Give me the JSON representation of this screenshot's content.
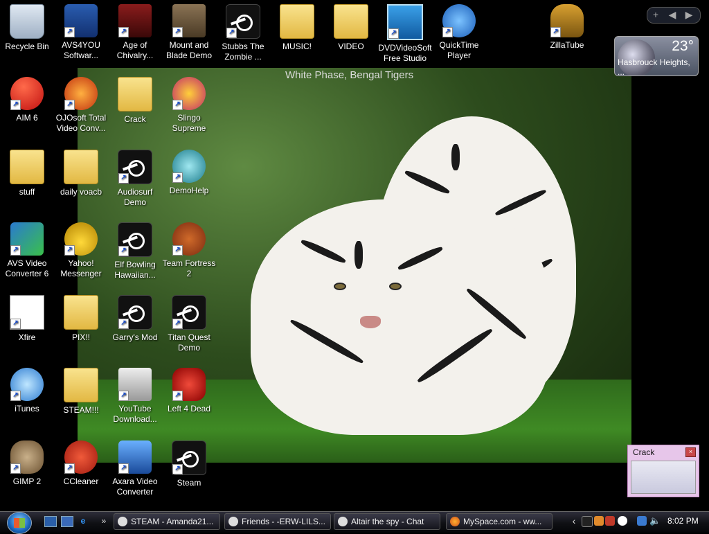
{
  "wallpaper": {
    "title": "White Phase, Bengal Tigers"
  },
  "desktop_icons": [
    {
      "label": "Recycle Bin",
      "icon": "recycle-bin-icon"
    },
    {
      "label": "AVS4YOU Softwar...",
      "icon": "avs4you-icon"
    },
    {
      "label": "Age of Chivalry...",
      "icon": "age-of-chivalry-icon"
    },
    {
      "label": "Mount and Blade Demo",
      "icon": "mount-blade-icon"
    },
    {
      "label": "Stubbs The Zombie ...",
      "icon": "steam-icon"
    },
    {
      "label": "MUSIC!",
      "icon": "folder-icon"
    },
    {
      "label": "VIDEO",
      "icon": "folder-icon"
    },
    {
      "label": "DVDVideoSoft Free Studio",
      "icon": "dvdvideosoft-icon"
    },
    {
      "label": "QuickTime Player",
      "icon": "quicktime-icon"
    },
    {
      "label": "ZillaTube",
      "icon": "zillatube-icon"
    },
    {
      "label": "AIM 6",
      "icon": "aim-icon"
    },
    {
      "label": "OJOsoft Total Video Conv...",
      "icon": "ojosoft-icon"
    },
    {
      "label": "Crack",
      "icon": "folder-icon"
    },
    {
      "label": "Slingo Supreme",
      "icon": "slingo-icon"
    },
    {
      "label": "stuff",
      "icon": "folder-icon"
    },
    {
      "label": "daily voacb",
      "icon": "folder-icon"
    },
    {
      "label": "Audiosurf Demo",
      "icon": "steam-icon"
    },
    {
      "label": "DemoHelp",
      "icon": "demohelp-icon"
    },
    {
      "label": "AVS Video Converter 6",
      "icon": "avs-video-converter-icon"
    },
    {
      "label": "Yahoo! Messenger",
      "icon": "yahoo-messenger-icon"
    },
    {
      "label": "Elf Bowling Hawaiian...",
      "icon": "steam-icon"
    },
    {
      "label": "Team Fortress 2",
      "icon": "team-fortress-icon"
    },
    {
      "label": "Xfire",
      "icon": "xfire-icon"
    },
    {
      "label": "PIX!!",
      "icon": "folder-icon"
    },
    {
      "label": "Garry's Mod",
      "icon": "steam-icon"
    },
    {
      "label": "Titan Quest Demo",
      "icon": "steam-icon"
    },
    {
      "label": "iTunes",
      "icon": "itunes-icon"
    },
    {
      "label": "STEAM!!!",
      "icon": "folder-icon"
    },
    {
      "label": "YouTube Download...",
      "icon": "youtube-downloader-icon"
    },
    {
      "label": "Left 4 Dead",
      "icon": "left4dead-icon"
    },
    {
      "label": "GIMP 2",
      "icon": "gimp-icon"
    },
    {
      "label": "CCleaner",
      "icon": "ccleaner-icon"
    },
    {
      "label": "Axara Video Converter",
      "icon": "axara-icon"
    },
    {
      "label": "Steam",
      "icon": "steam-icon"
    }
  ],
  "gadgets": {
    "bar": {
      "add": "+",
      "prev": "◀",
      "next": "▶"
    },
    "weather": {
      "temp": "23°",
      "city": "Hasbrouck Heights, ..."
    }
  },
  "crack_window": {
    "title": "Crack",
    "close": "×"
  },
  "taskbar": {
    "tasks": [
      {
        "label": "STEAM - Amanda21...",
        "icon": "steam-icon"
      },
      {
        "label": "Friends - -ERW-LILS...",
        "icon": "steam-icon"
      },
      {
        "label": "Altair the spy - Chat",
        "icon": "steam-icon"
      },
      {
        "label": "MySpace.com - ww...",
        "icon": "firefox-icon"
      }
    ],
    "quicklaunch": [
      "show-desktop-icon",
      "switch-windows-icon",
      "ie-icon"
    ],
    "quicklaunch_more": "»",
    "tray_expand": "‹",
    "clock": "8:02 PM"
  },
  "colors": {
    "taskbar": "#0f1014",
    "weather_bg": "#4a5262",
    "crack_window": "#e7c6ea"
  }
}
